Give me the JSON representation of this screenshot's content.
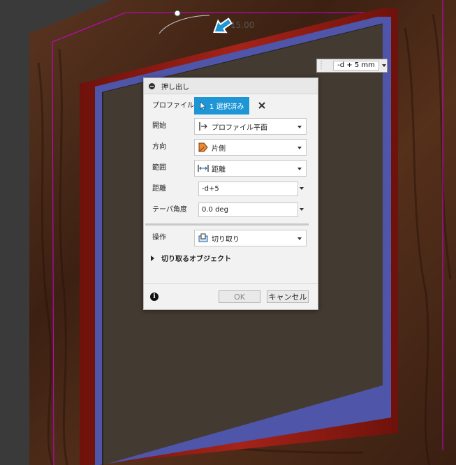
{
  "dialog": {
    "title": "押し出し",
    "rows": {
      "profile": {
        "label": "プロファイル",
        "value": "1 選択済み"
      },
      "start": {
        "label": "開始",
        "value": "プロファイル平面"
      },
      "direction": {
        "label": "方向",
        "value": "片側"
      },
      "extent": {
        "label": "範囲",
        "value": "距離"
      },
      "distance": {
        "label": "距離",
        "value": "-d+5"
      },
      "taper": {
        "label": "テーパ角度",
        "value": "0.0 deg"
      },
      "operation": {
        "label": "操作",
        "value": "切り取り"
      }
    },
    "objects_to_cut": "切り取るオブジェクト",
    "ok_label": "OK",
    "cancel_label": "キャンセル"
  },
  "canvas": {
    "distance_input": "-d + 5 mm",
    "angle_label": "15.00",
    "colors": {
      "background": "#3a3a3a",
      "wood": "#4a2a18",
      "red_frame": "#8f1a10",
      "blue_edge": "#4f55a8",
      "panel": "#433a31",
      "highlight": "#d000d0",
      "accent": "#1e96d6"
    }
  }
}
